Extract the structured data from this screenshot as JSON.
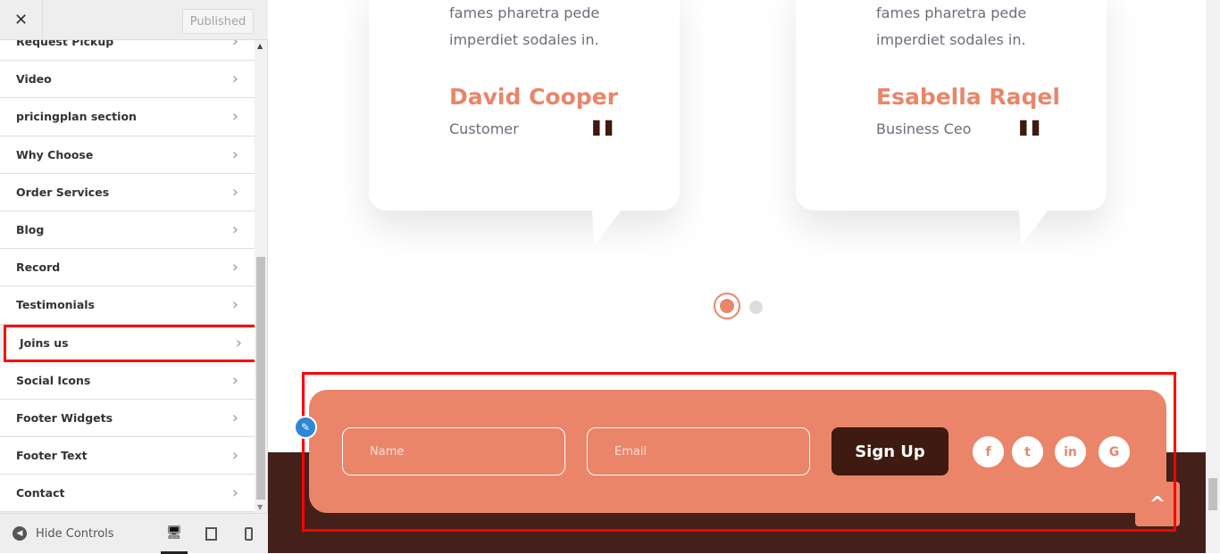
{
  "sidebar": {
    "close_label": "✕",
    "published_label": "Published",
    "items": [
      {
        "label": "Request Pickup"
      },
      {
        "label": "Video"
      },
      {
        "label": "pricingplan section"
      },
      {
        "label": "Why Choose"
      },
      {
        "label": "Order Services"
      },
      {
        "label": "Blog"
      },
      {
        "label": "Record"
      },
      {
        "label": "Testimonials"
      },
      {
        "label": "Joins us",
        "highlighted": true
      },
      {
        "label": "Social Icons"
      },
      {
        "label": "Footer Widgets"
      },
      {
        "label": "Footer Text"
      },
      {
        "label": "Contact"
      }
    ],
    "hide_controls": "Hide Controls",
    "devices": [
      "desktop-icon",
      "tablet-icon",
      "mobile-icon"
    ]
  },
  "testimonials": [
    {
      "text": "fames pharetra pede imperdiet sodales in.",
      "name": "David Cooper",
      "role": "Customer"
    },
    {
      "text": "fames pharetra pede imperdiet sodales in.",
      "name": "Esabella Raqel",
      "role": "Business Ceo"
    }
  ],
  "quote_mark": "\"",
  "carousel": {
    "active": 1,
    "count": 2
  },
  "newsletter": {
    "name_placeholder": "Name",
    "email_placeholder": "Email",
    "signup_label": "Sign Up",
    "social": [
      {
        "icon": "facebook-icon",
        "glyph": "f"
      },
      {
        "icon": "twitter-icon",
        "glyph": "t"
      },
      {
        "icon": "linkedin-icon",
        "glyph": "in"
      },
      {
        "icon": "google-icon",
        "glyph": "G"
      }
    ]
  },
  "colors": {
    "accent": "#ea856a",
    "dark": "#3e1a10",
    "highlight": "#ff0000"
  }
}
